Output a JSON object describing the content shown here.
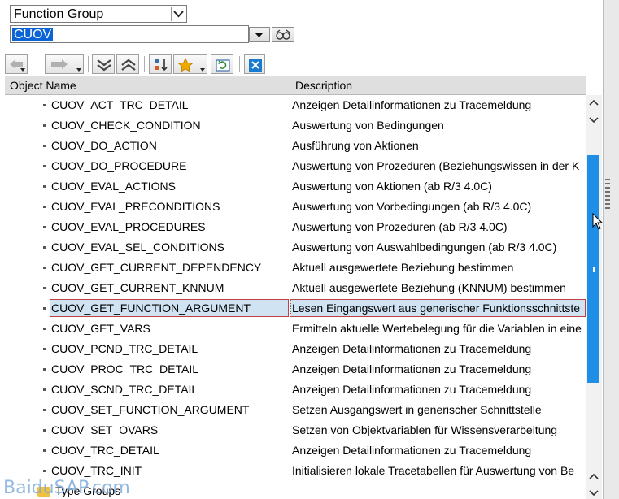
{
  "selector": {
    "object_type": "Function Group",
    "object_name": "CUOV"
  },
  "header": {
    "col_name": "Object Name",
    "col_desc": "Description"
  },
  "rows": [
    {
      "name": "CUOV_ACT_TRC_DETAIL",
      "desc": "Anzeigen Detailinformationen zu Tracemeldung"
    },
    {
      "name": "CUOV_CHECK_CONDITION",
      "desc": "Auswertung von Bedingungen"
    },
    {
      "name": "CUOV_DO_ACTION",
      "desc": "Ausführung von Aktionen"
    },
    {
      "name": "CUOV_DO_PROCEDURE",
      "desc": "Auswertung von Prozeduren (Beziehungswissen in der K"
    },
    {
      "name": "CUOV_EVAL_ACTIONS",
      "desc": "Auswertung von Aktionen (ab R/3 4.0C)"
    },
    {
      "name": "CUOV_EVAL_PRECONDITIONS",
      "desc": "Auswertung von Vorbedingungen (ab R/3 4.0C)"
    },
    {
      "name": "CUOV_EVAL_PROCEDURES",
      "desc": "Auswertung von Prozeduren (ab R/3 4.0C)"
    },
    {
      "name": "CUOV_EVAL_SEL_CONDITIONS",
      "desc": "Auswertung von Auswahlbedingungen (ab R/3 4.0C)"
    },
    {
      "name": "CUOV_GET_CURRENT_DEPENDENCY",
      "desc": "Aktuell ausgewertete Beziehung bestimmen"
    },
    {
      "name": "CUOV_GET_CURRENT_KNNUM",
      "desc": "Aktuell ausgewertete Beziehung (KNNUM) bestimmen"
    },
    {
      "name": "CUOV_GET_FUNCTION_ARGUMENT",
      "desc": "Lesen Eingangswert aus generischer Funktionsschnittste",
      "selected": true
    },
    {
      "name": "CUOV_GET_VARS",
      "desc": "Ermitteln aktuelle Wertebelegung für die Variablen in eine"
    },
    {
      "name": "CUOV_PCND_TRC_DETAIL",
      "desc": "Anzeigen Detailinformationen zu Tracemeldung"
    },
    {
      "name": "CUOV_PROC_TRC_DETAIL",
      "desc": "Anzeigen Detailinformationen zu Tracemeldung"
    },
    {
      "name": "CUOV_SCND_TRC_DETAIL",
      "desc": "Anzeigen Detailinformationen zu Tracemeldung"
    },
    {
      "name": "CUOV_SET_FUNCTION_ARGUMENT",
      "desc": "Setzen Ausgangswert in generischer Schnittstelle"
    },
    {
      "name": "CUOV_SET_OVARS",
      "desc": "Setzen von Objektvariablen für Wissensverarbeitung"
    },
    {
      "name": "CUOV_TRC_DETAIL",
      "desc": "Anzeigen Detailinformationen zu Tracemeldung"
    },
    {
      "name": "CUOV_TRC_INIT",
      "desc": "Initialisieren lokale Tracetabellen für Auswertung von Be"
    }
  ],
  "folder_row": {
    "name": "Type Groups"
  },
  "watermark": "BaiduSAP.com",
  "icons": {
    "toolbar": [
      "back-arrow-icon",
      "forward-arrow-icon",
      "expand-all-icon",
      "collapse-all-icon",
      "sort-icon",
      "favorites-star-icon",
      "refresh-icon",
      "close-icon"
    ]
  },
  "colors": {
    "selection": "#0a64d6",
    "row_highlight": "#cfe3f3",
    "scroll_thumb": "#1e8ee6",
    "star": "#f0a800"
  }
}
